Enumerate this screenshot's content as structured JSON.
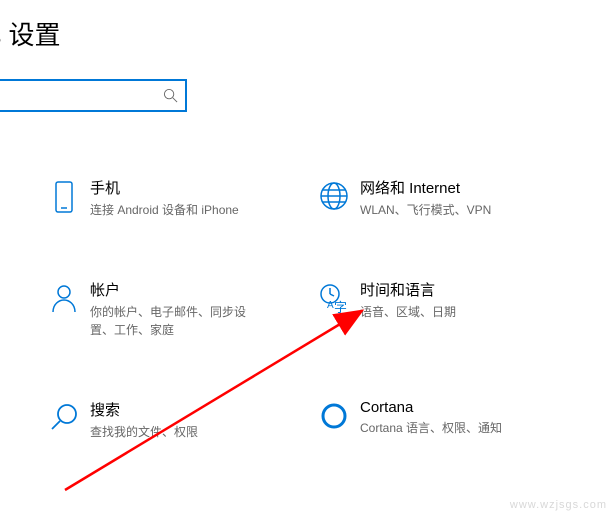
{
  "header": {
    "title": "ows 设置"
  },
  "search": {
    "placeholder": ""
  },
  "tiles": {
    "phone": {
      "title": "手机",
      "desc": "连接 Android 设备和 iPhone"
    },
    "network": {
      "title": "网络和 Internet",
      "desc": "WLAN、飞行模式、VPN"
    },
    "accounts": {
      "title": "帐户",
      "desc": "你的帐户、电子邮件、同步设置、工作、家庭"
    },
    "time": {
      "title": "时间和语言",
      "desc": "语音、区域、日期"
    },
    "search_tile": {
      "title": "搜索",
      "desc": "查找我的文件、权限"
    },
    "cortana": {
      "title": "Cortana",
      "desc": "Cortana 语言、权限、通知"
    }
  },
  "watermark": "www.wzjsgs.com"
}
